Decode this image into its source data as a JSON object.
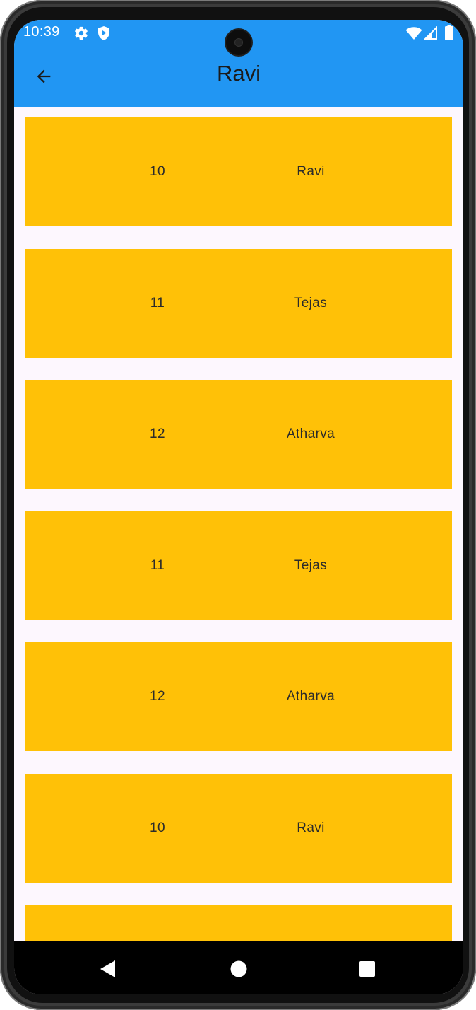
{
  "status_bar": {
    "time": "10:39",
    "icons": [
      "gear-icon",
      "shield-play-icon",
      "wifi-icon",
      "signal-icon",
      "battery-icon"
    ]
  },
  "app_bar": {
    "title": "Ravi",
    "back_icon": "arrow-back-icon",
    "color": "#2196f3"
  },
  "list": {
    "card_color": "#ffc107",
    "items": [
      {
        "id": "10",
        "name": "Ravi"
      },
      {
        "id": "11",
        "name": "Tejas"
      },
      {
        "id": "12",
        "name": "Atharva"
      },
      {
        "id": "11",
        "name": "Tejas"
      },
      {
        "id": "12",
        "name": "Atharva"
      },
      {
        "id": "10",
        "name": "Ravi"
      },
      {
        "id": "",
        "name": ""
      }
    ]
  },
  "nav_bar": {
    "icons": [
      "back-triangle-icon",
      "home-circle-icon",
      "recents-square-icon"
    ]
  }
}
